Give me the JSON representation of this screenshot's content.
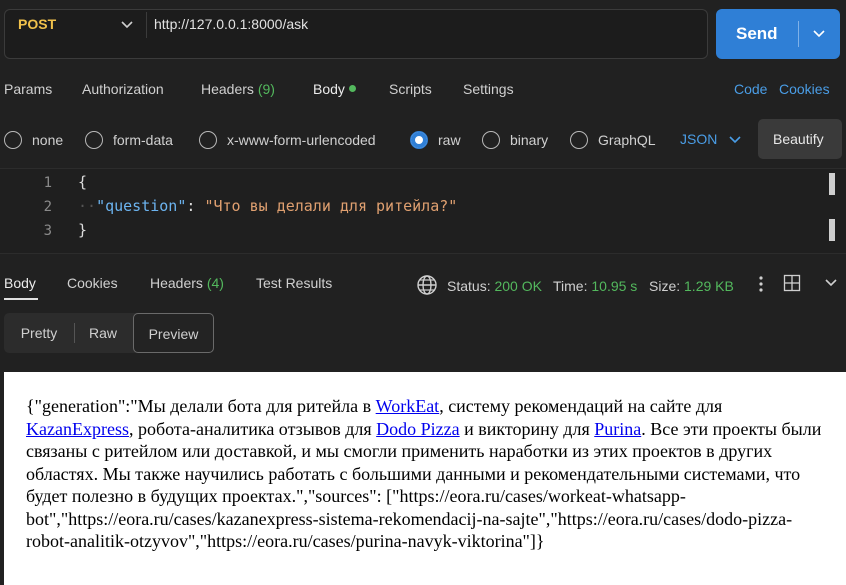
{
  "request": {
    "method": "POST",
    "url": "http://127.0.0.1:8000/ask",
    "send_label": "Send"
  },
  "request_tabs": {
    "params": "Params",
    "authorization": "Authorization",
    "headers": "Headers",
    "headers_count": "(9)",
    "body": "Body",
    "scripts": "Scripts",
    "settings": "Settings",
    "code": "Code",
    "cookies": "Cookies"
  },
  "body_types": {
    "none": "none",
    "form_data": "form-data",
    "urlencoded": "x-www-form-urlencoded",
    "raw": "raw",
    "binary": "binary",
    "graphql": "GraphQL",
    "selected": "raw",
    "format": "JSON",
    "beautify": "Beautify"
  },
  "editor": {
    "line_numbers": [
      "1",
      "2",
      "3"
    ],
    "open_brace": "{",
    "indent": "··",
    "key": "\"question\"",
    "colon": ": ",
    "value": "\"Что вы делали для ритейла?\"",
    "close_brace": "}"
  },
  "response_tabs": {
    "body": "Body",
    "cookies": "Cookies",
    "headers": "Headers",
    "headers_count": "(4)",
    "test_results": "Test Results"
  },
  "response_status": {
    "status_label": "Status:",
    "status_value": "200 OK",
    "time_label": "Time:",
    "time_value": "10.95 s",
    "size_label": "Size:",
    "size_value": "1.29 KB"
  },
  "views": {
    "pretty": "Pretty",
    "raw": "Raw",
    "preview": "Preview",
    "selected": "Preview"
  },
  "preview": {
    "t1": "{\"generation\":\"Мы делали бота для ритейла в ",
    "link1": "WorkEat",
    "t2": ", систему рекомендаций на сайте для ",
    "link2": "KazanExpress",
    "t3": ", робота-аналитика отзывов для ",
    "link3": "Dodo Pizza",
    "t4": " и викторину для ",
    "link4": "Purina",
    "t5": ". Все эти проекты были связаны с ритейлом или доставкой, и мы смогли применить наработки из этих проектов в других областях. Мы также научились работать с большими данными и рекомендательными системами, что будет полезно в будущих проектах.\",\"sources\": [\"https://eora.ru/cases/workeat-whatsapp-bot\",\"https://eora.ru/cases/kazanexpress-sistema-rekomendacij-na-sajte\",\"https://eora.ru/cases/dodo-pizza-robot-analitik-otzyvov\",\"https://eora.ru/cases/purina-navyk-viktorina\"]}"
  },
  "colors": {
    "method": "#f0c14b",
    "accent": "#2f7fd6",
    "success": "#53b85d",
    "link": "#4a9de6",
    "json_key": "#6cb4f0",
    "json_string": "#e0a070"
  },
  "icons": {
    "method_dropdown": "chevron-down-icon",
    "send_dropdown": "chevron-down-icon",
    "format_dropdown": "chevron-down-icon",
    "network": "globe-icon",
    "more": "more-vertical-icon",
    "layout": "layout-icon",
    "collapse": "chevron-down-icon"
  }
}
